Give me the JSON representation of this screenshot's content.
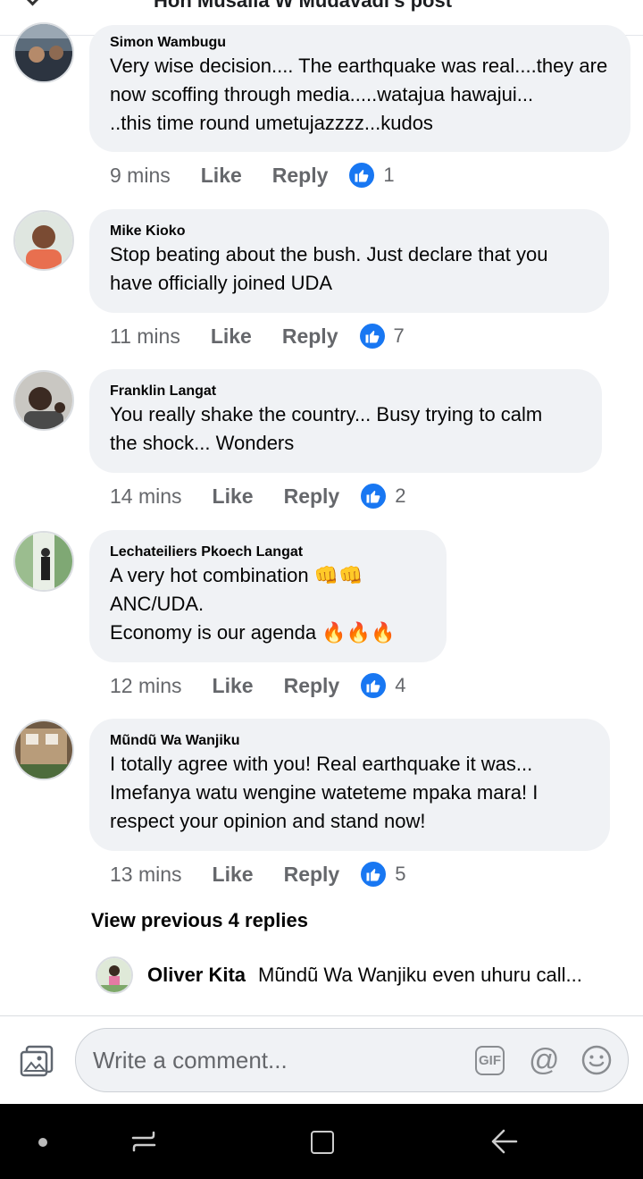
{
  "header": {
    "title": "Hon Musalia W Mudavadi's post"
  },
  "comments": [
    {
      "author": "Simon Wambugu",
      "text": "Very wise decision.... The earthquake was real....they are now scoffing through media.....watajua hawajui...\n..this time round umetujazzzz...kudos",
      "time": "9 mins",
      "like": "Like",
      "reply": "Reply",
      "reactions": "1"
    },
    {
      "author": "Mike Kioko",
      "text": "Stop beating about the bush. Just declare that you\nhave officially joined UDA",
      "time": "11 mins",
      "like": "Like",
      "reply": "Reply",
      "reactions": "7"
    },
    {
      "author": "Franklin Langat",
      "text": "You really shake the country... Busy trying to calm\nthe shock... Wonders",
      "time": "14 mins",
      "like": "Like",
      "reply": "Reply",
      "reactions": "2"
    },
    {
      "author": "Lechateiliers Pkoech Langat",
      "text": "A very hot combination 👊👊\nANC/UDA.\nEconomy is our agenda 🔥🔥🔥",
      "time": "12 mins",
      "like": "Like",
      "reply": "Reply",
      "reactions": "4"
    },
    {
      "author": "Mũndũ Wa Wanjiku",
      "text": "I totally agree with you! Real earthquake it was...\nImefanya watu wengine wateteme mpaka mara!  I\nrespect your opinion and stand now!",
      "time": "13 mins",
      "like": "Like",
      "reply": "Reply",
      "reactions": "5"
    }
  ],
  "view_previous": "View previous 4 replies",
  "reply_preview": {
    "author": "Oliver Kita",
    "text": "Mũndũ Wa Wanjiku even uhuru call..."
  },
  "composer": {
    "placeholder": "Write a comment...",
    "gif": "GIF",
    "at": "@"
  },
  "icons": {
    "photo": "photo-icon",
    "gif": "gif-icon",
    "mention": "at-icon",
    "emoji": "emoji-icon",
    "like_reaction": "thumbs-up-icon",
    "nav_back": "back-icon"
  },
  "colors": {
    "like_blue": "#1877f2",
    "bubble": "#f0f2f5",
    "meta": "#65676b"
  }
}
